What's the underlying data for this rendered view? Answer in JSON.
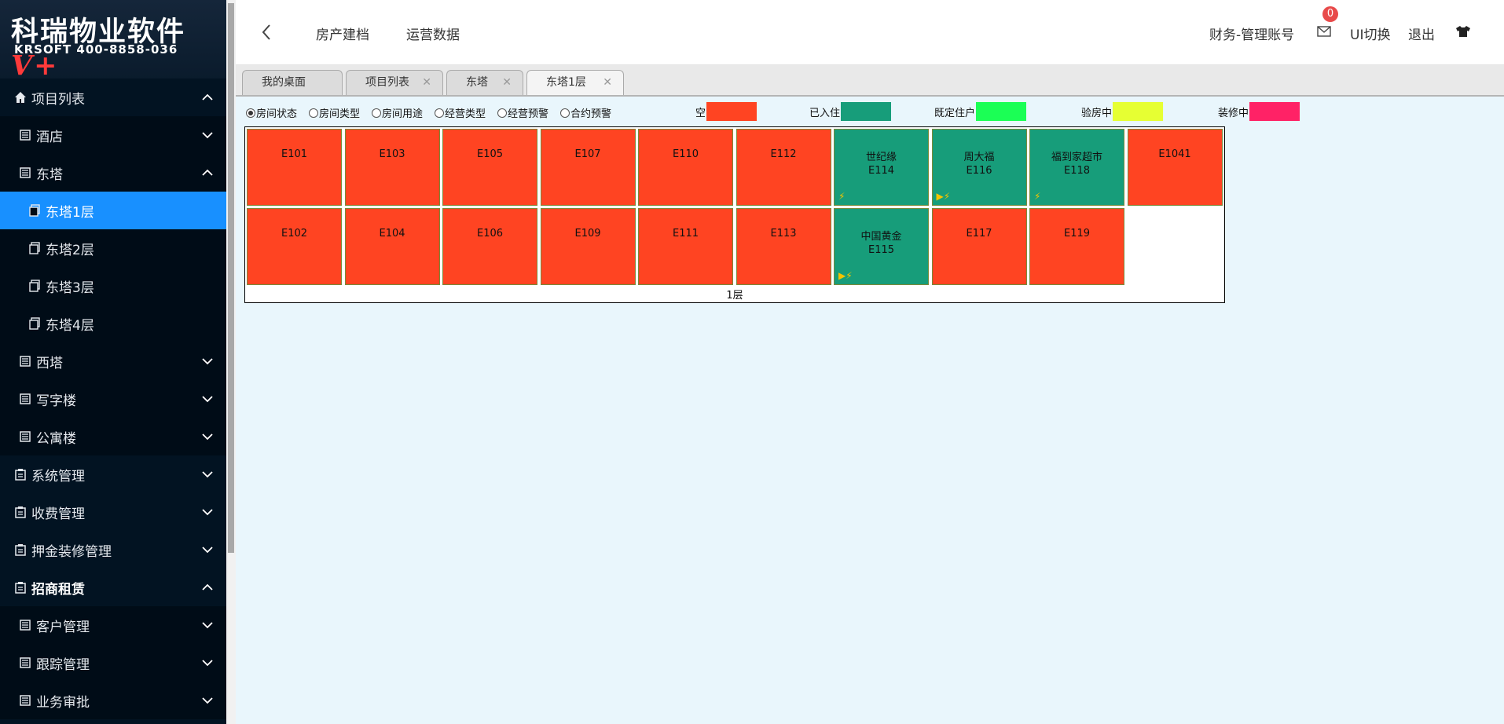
{
  "brand": {
    "main": "科瑞物业软件",
    "badge": "V+",
    "sub": "KRSOFT 400-8858-036"
  },
  "sidebar": {
    "items": [
      {
        "label": "项目列表",
        "level": 0,
        "expanded": true
      },
      {
        "label": "酒店",
        "level": 1,
        "expanded": false
      },
      {
        "label": "东塔",
        "level": 1,
        "expanded": true
      },
      {
        "label": "东塔1层",
        "level": 2,
        "active": true
      },
      {
        "label": "东塔2层",
        "level": 2
      },
      {
        "label": "东塔3层",
        "level": 2
      },
      {
        "label": "东塔4层",
        "level": 2
      },
      {
        "label": "西塔",
        "level": 1,
        "expanded": false
      },
      {
        "label": "写字楼",
        "level": 1,
        "expanded": false
      },
      {
        "label": "公寓楼",
        "level": 1,
        "expanded": false
      },
      {
        "label": "系统管理",
        "level": 0,
        "expanded": false
      },
      {
        "label": "收费管理",
        "level": 0,
        "expanded": false
      },
      {
        "label": "押金装修管理",
        "level": 0,
        "expanded": false
      },
      {
        "label": "招商租赁",
        "level": 0,
        "expanded": true,
        "bold": true
      },
      {
        "label": "客户管理",
        "level": 1,
        "expanded": false
      },
      {
        "label": "跟踪管理",
        "level": 1,
        "expanded": false
      },
      {
        "label": "业务审批",
        "level": 1,
        "expanded": false
      }
    ]
  },
  "topbar": {
    "menu": [
      "房产建档",
      "运营数据"
    ],
    "account": "财务-管理账号",
    "mail_count": "0",
    "ui_switch": "UI切换",
    "logout": "退出"
  },
  "tabs": [
    {
      "label": "我的桌面",
      "closable": false
    },
    {
      "label": "项目列表",
      "closable": true
    },
    {
      "label": "东塔",
      "closable": true
    },
    {
      "label": "东塔1层",
      "closable": true,
      "current": true
    }
  ],
  "filters": [
    "房间状态",
    "房间类型",
    "房间用途",
    "经营类型",
    "经营预警",
    "合约预警"
  ],
  "legend": [
    {
      "label": "空",
      "color": "#ff4422"
    },
    {
      "label": "已入住",
      "color": "#179d7a"
    },
    {
      "label": "既定住户",
      "color": "#1bff55"
    },
    {
      "label": "验房中",
      "color": "#e6ff33"
    },
    {
      "label": "装修中",
      "color": "#ff2266"
    }
  ],
  "floor_label": "1层",
  "rooms_row1": [
    {
      "code": "E101",
      "status": "空"
    },
    {
      "code": "E103",
      "status": "空"
    },
    {
      "code": "E105",
      "status": "空"
    },
    {
      "code": "E107",
      "status": "空"
    },
    {
      "code": "E110",
      "status": "空"
    },
    {
      "code": "E112",
      "status": "空"
    },
    {
      "code": "E114",
      "tenant": "世纪缘",
      "status": "已入住",
      "icons": "⚡"
    },
    {
      "code": "E116",
      "tenant": "周大福",
      "status": "已入住",
      "icons": "▶⚡"
    },
    {
      "code": "E118",
      "tenant": "福到家超市",
      "status": "已入住",
      "icons": "⚡"
    },
    {
      "code": "E1041",
      "status": "空"
    }
  ],
  "rooms_row2": [
    {
      "code": "E102",
      "status": "空"
    },
    {
      "code": "E104",
      "status": "空"
    },
    {
      "code": "E106",
      "status": "空"
    },
    {
      "code": "E109",
      "status": "空"
    },
    {
      "code": "E111",
      "status": "空"
    },
    {
      "code": "E113",
      "status": "空"
    },
    {
      "code": "E115",
      "tenant": "中国黄金",
      "status": "已入住",
      "icons": "▶⚡"
    },
    {
      "code": "E117",
      "status": "空"
    },
    {
      "code": "E119",
      "status": "空"
    }
  ]
}
